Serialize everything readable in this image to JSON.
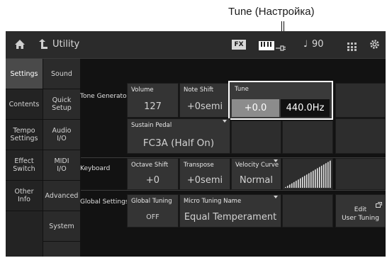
{
  "callout": {
    "label": "Tune (Настройка)"
  },
  "topbar": {
    "home_icon": "home-icon",
    "back_icon": "return-arrow-icon",
    "title": "Utility",
    "fx_badge": "FX",
    "keyboard_icon": "keyboard-icon",
    "cable_icon": "cable-icon",
    "tempo_icon": "quarter-note-icon",
    "tempo": "90",
    "grid_icon": "grid-icon",
    "settings_icon": "gear-icon"
  },
  "sidebar": {
    "col1": [
      "Settings",
      "Contents",
      "Tempo\nSettings",
      "Effect\nSwitch",
      "Other\nInfo"
    ],
    "col2": [
      "Sound",
      "Quick\nSetup",
      "Audio\nI/O",
      "MIDI\nI/O",
      "Advanced",
      "System"
    ]
  },
  "sections": {
    "tone_generator": "Tone Generator",
    "keyboard": "Keyboard",
    "global_settings": "Global Settings"
  },
  "params": {
    "volume": {
      "label": "Volume",
      "value": "127"
    },
    "note_shift": {
      "label": "Note Shift",
      "value": "+0semi"
    },
    "tune": {
      "label": "Tune",
      "value": "+0.0",
      "hz": "440.0Hz"
    },
    "sustain_pedal": {
      "label": "Sustain Pedal",
      "value": "FC3A (Half On)"
    },
    "octave_shift": {
      "label": "Octave Shift",
      "value": "+0"
    },
    "transpose": {
      "label": "Transpose",
      "value": "+0semi"
    },
    "velocity_curve": {
      "label": "Velocity Curve",
      "value": "Normal"
    },
    "global_tuning": {
      "label": "Global Tuning",
      "value": "OFF"
    },
    "micro_tuning": {
      "label": "Micro Tuning Name",
      "value": "Equal Temperament"
    },
    "edit_user_tuning": {
      "label": "Edit\nUser Tuning"
    }
  },
  "colors": {
    "screen_bg": "#121212",
    "cell_bg": "#343434",
    "highlight": "#ffffff",
    "selected_value_bg": "#8c8c8c"
  }
}
